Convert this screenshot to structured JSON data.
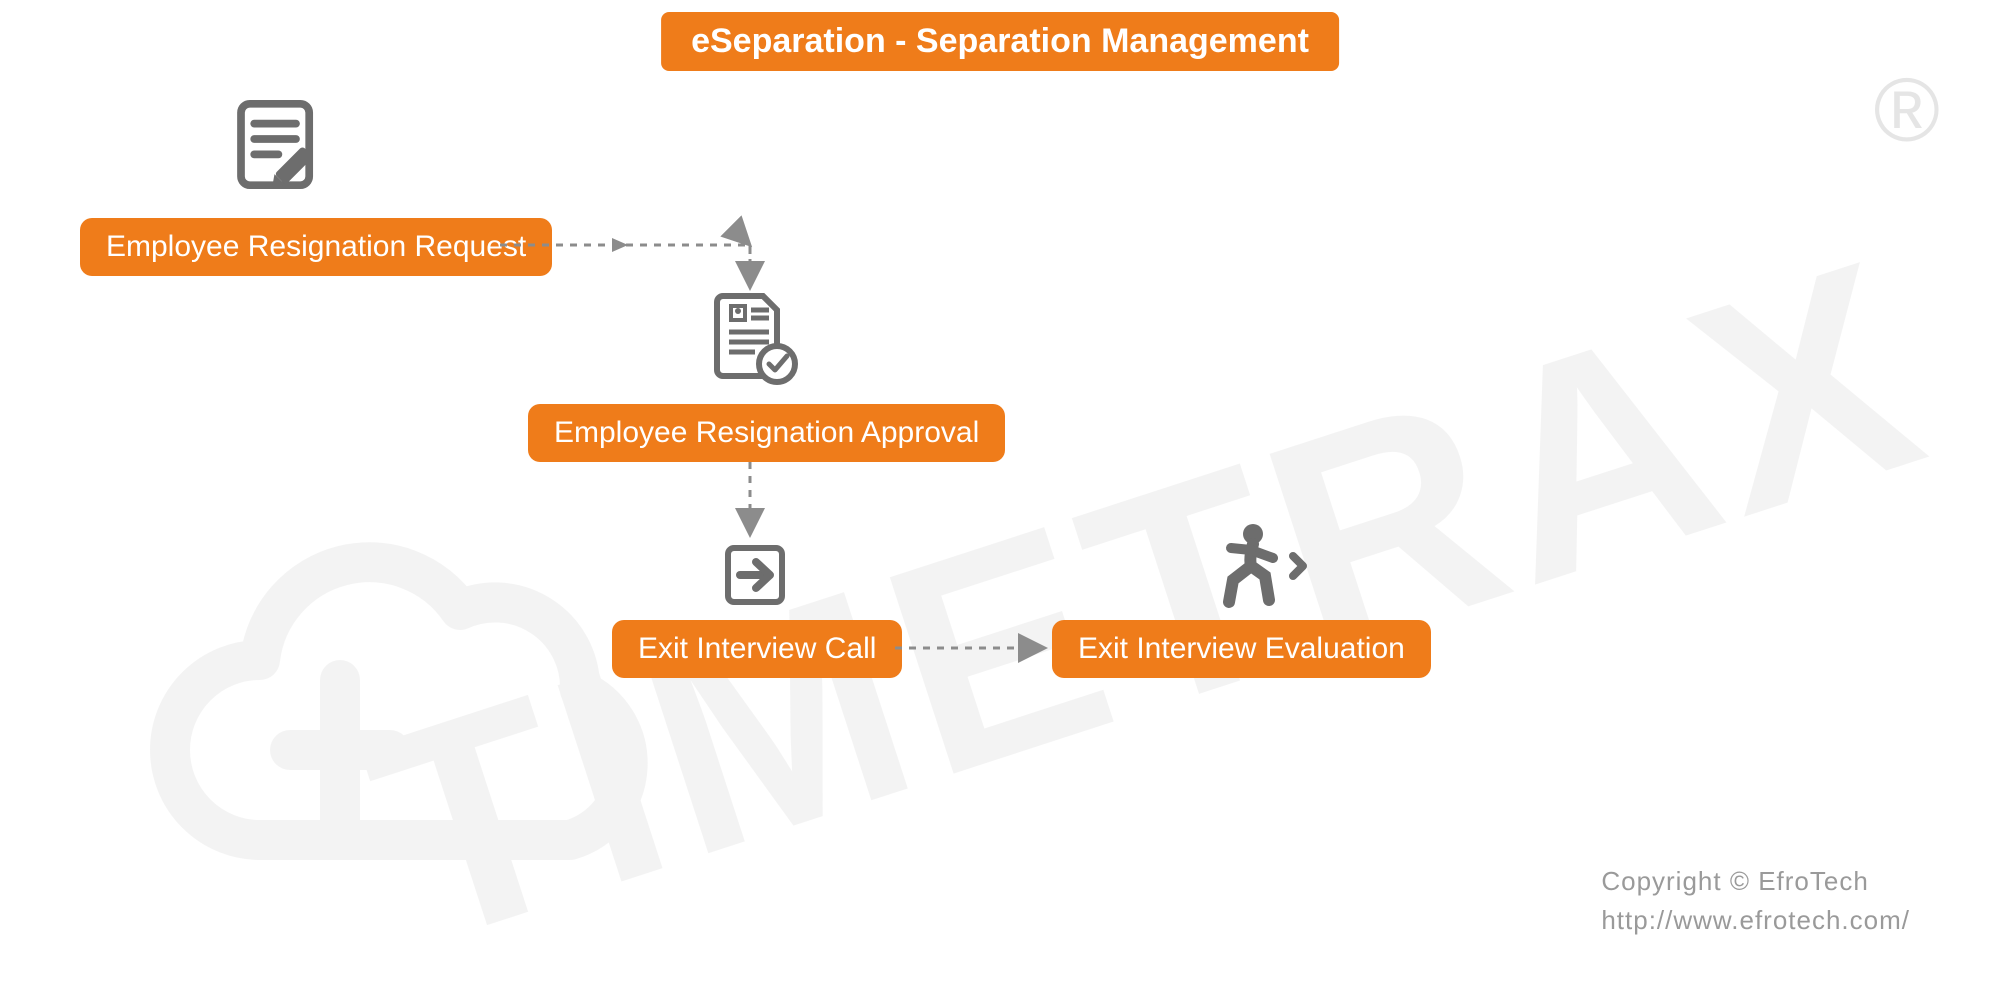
{
  "title": "eSeparation - Separation Management",
  "nodes": {
    "request": "Employee Resignation Request",
    "approval": "Employee Resignation Approval",
    "call": "Exit Interview Call",
    "evaluation": "Exit Interview Evaluation"
  },
  "watermark": "TIMETRAX",
  "reg": "®",
  "credits": {
    "line1": "Copyright © EfroTech",
    "line2": "http://www.efrotech.com/"
  },
  "colors": {
    "accent": "#ef7c1a",
    "iconGray": "#6d6d6d",
    "arrowGray": "#8c8c8c",
    "wmGray": "#777777"
  }
}
